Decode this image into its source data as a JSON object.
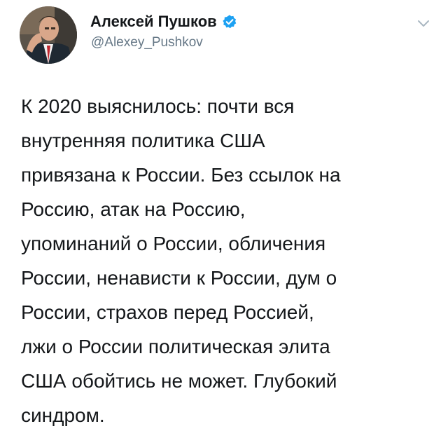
{
  "author": {
    "display_name": "Алексей Пушков",
    "handle": "@Alexey_Pushkov",
    "verified": true,
    "avatar": "avatar-photo"
  },
  "tweet": {
    "lines": [
      "К 2020 выяснилось: почти вся",
      "внутренняя политика США",
      "привязана к России. Без ссылок на",
      "Россию, атак на Россию,",
      "упоминаний о России, обличения",
      "России, ненависти к России, дум о",
      "России, страхов перед Россией,",
      "лжи о России политическая элита",
      "США обойтись не может. Глубокий",
      "синдром."
    ]
  },
  "icons": {
    "verified": "verified-badge-icon",
    "more": "chevron-down-icon"
  },
  "colors": {
    "verified": "#1da1f2",
    "text": "#14171a",
    "secondary": "#657786",
    "caret": "#aab8c2"
  }
}
